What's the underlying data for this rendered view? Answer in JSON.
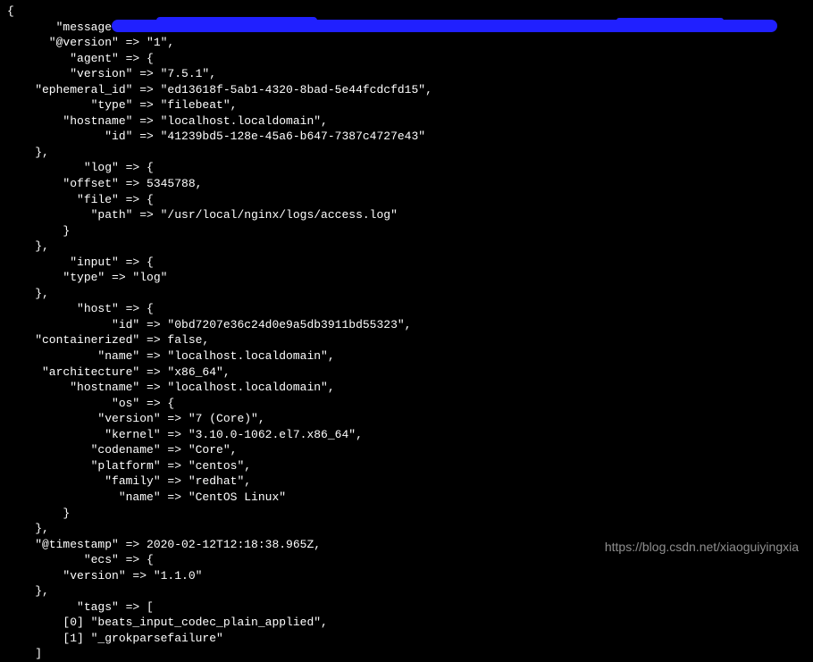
{
  "lines": {
    "open": "{",
    "message": "       \"message\" => \"",
    "version": "      \"@version\" => \"1\",",
    "agent_open": "         \"agent\" => {",
    "agent_version": "         \"version\" => \"7.5.1\",",
    "agent_ephemeral": "    \"ephemeral_id\" => \"ed13618f-5ab1-4320-8bad-5e44fcdcfd15\",",
    "agent_type": "            \"type\" => \"filebeat\",",
    "agent_hostname": "        \"hostname\" => \"localhost.localdomain\",",
    "agent_id": "              \"id\" => \"41239bd5-128e-45a6-b647-7387c4727e43\"",
    "agent_close": "    },",
    "log_open": "           \"log\" => {",
    "log_offset": "        \"offset\" => 5345788,",
    "log_file_open": "          \"file\" => {",
    "log_file_path": "            \"path\" => \"/usr/local/nginx/logs/access.log\"",
    "log_file_close": "        }",
    "log_close": "    },",
    "input_open": "         \"input\" => {",
    "input_type": "        \"type\" => \"log\"",
    "input_close": "    },",
    "host_open": "          \"host\" => {",
    "host_id": "               \"id\" => \"0bd7207e36c24d0e9a5db3911bd55323\",",
    "host_containerized": "    \"containerized\" => false,",
    "host_name": "             \"name\" => \"localhost.localdomain\",",
    "host_arch": "     \"architecture\" => \"x86_64\",",
    "host_hostname": "         \"hostname\" => \"localhost.localdomain\",",
    "host_os_open": "               \"os\" => {",
    "os_version": "             \"version\" => \"7 (Core)\",",
    "os_kernel": "              \"kernel\" => \"3.10.0-1062.el7.x86_64\",",
    "os_codename": "            \"codename\" => \"Core\",",
    "os_platform": "            \"platform\" => \"centos\",",
    "os_family": "              \"family\" => \"redhat\",",
    "os_name": "                \"name\" => \"CentOS Linux\"",
    "os_close": "        }",
    "host_close": "    },",
    "timestamp": "    \"@timestamp\" => 2020-02-12T12:18:38.965Z,",
    "ecs_open": "           \"ecs\" => {",
    "ecs_version": "        \"version\" => \"1.1.0\"",
    "ecs_close": "    },",
    "tags_open": "          \"tags\" => [",
    "tags_0": "        [0] \"beats_input_codec_plain_applied\",",
    "tags_1": "        [1] \"_grokparsefailure\"",
    "tags_close": "    ]"
  },
  "watermark": "https://blog.csdn.net/xiaoguiyingxia"
}
